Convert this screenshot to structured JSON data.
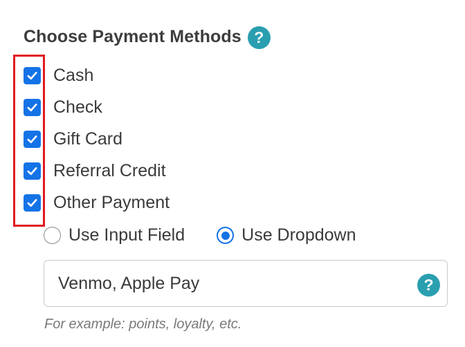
{
  "section": {
    "title": "Choose Payment Methods",
    "help_glyph": "?"
  },
  "colors": {
    "accent": "#1473e6",
    "help": "#2a9fb0",
    "highlight": "#e0191f"
  },
  "payment_methods": [
    {
      "label": "Cash",
      "checked": true
    },
    {
      "label": "Check",
      "checked": true
    },
    {
      "label": "Gift Card",
      "checked": true
    },
    {
      "label": "Referral Credit",
      "checked": true
    },
    {
      "label": "Other Payment",
      "checked": true
    }
  ],
  "other_payment": {
    "mode_options": [
      {
        "label": "Use Input Field",
        "selected": false
      },
      {
        "label": "Use Dropdown",
        "selected": true
      }
    ],
    "input_value": "Venmo, Apple Pay",
    "help_glyph": "?",
    "hint": "For example: points, loyalty, etc."
  }
}
